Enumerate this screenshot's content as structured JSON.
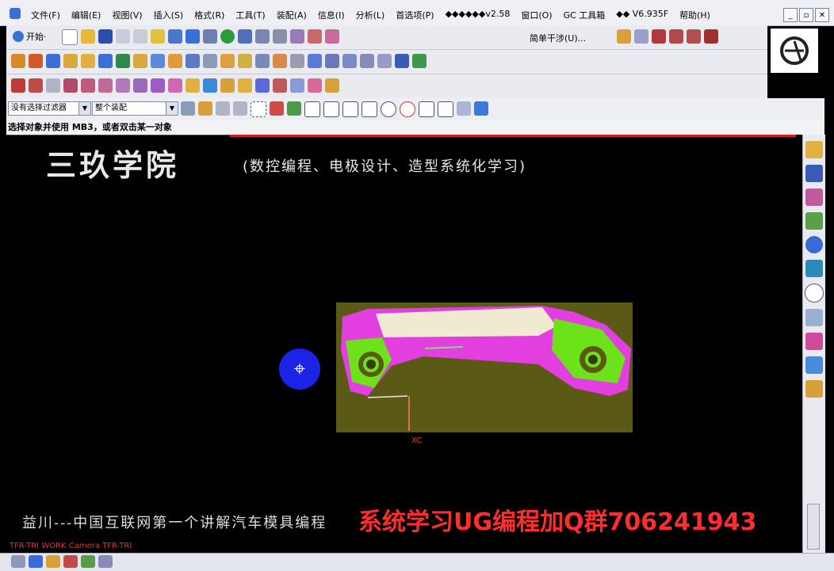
{
  "menubar": {
    "items": [
      "文件(F)",
      "编辑(E)",
      "视图(V)",
      "插入(S)",
      "格式(R)",
      "工具(T)",
      "装配(A)",
      "信息(I)",
      "分析(L)",
      "首选项(P)",
      "◆◆◆◆◆◆v2.58",
      "窗口(O)",
      "GC 工具箱",
      "◆◆ V6.935F",
      "帮助(H)"
    ],
    "window_controls": [
      "_",
      "▫",
      "✕"
    ]
  },
  "toolbar": {
    "start_label": "开始·",
    "simple_interference": "简单干涉(U)...",
    "filter_select": "没有选择过滤器",
    "assembly_select": "整个装配"
  },
  "status": {
    "prompt": "选择对象并使用 MB3，或者双击某一对象"
  },
  "viewport": {
    "academy_title": "三玖学院",
    "academy_subtitle": "(数控编程、电极设计、造型系统化学习)",
    "axis_label": "XC",
    "bottom_caption": "益川---中国互联网第一个讲解汽车模具编程",
    "watermark": "系统学习UG编程加Q群706241943",
    "camera_label": "TFR-TRI WORK Camera TFR-TRI"
  },
  "colors": {
    "menubar_bg": "#eef0f6",
    "toolbar_bg": "#e9ebf1",
    "viewport_bg": "#000000",
    "part_bg": "#5b5916",
    "part_magenta": "#e23ee0",
    "part_green": "#6de21a",
    "part_cream": "#f0ead0",
    "cursor_blue": "#1b23e6",
    "watermark_red": "#ff2d2d"
  }
}
